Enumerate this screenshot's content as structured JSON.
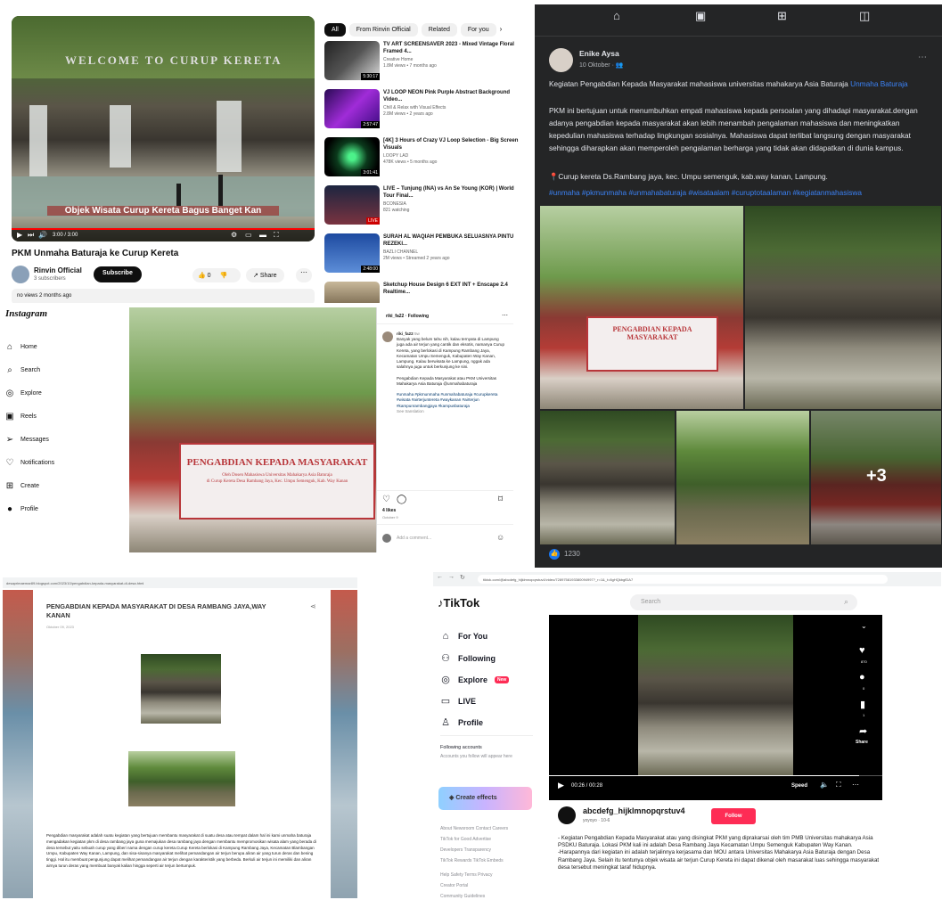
{
  "youtube": {
    "video_title": "PKM Unmaha Baturaja ke Curup Kereta",
    "sign_text": "WELCOME TO CURUP KERETA",
    "caption": "Objek Wisata Curup Kereta Bagus Banget Kan",
    "time": "3:00 / 3:00",
    "channel": "Rinvin Official",
    "subscribers": "3 subscribers",
    "subscribe_label": "Subscribe",
    "likes": "0",
    "share_label": "Share",
    "views": "no views  2 months ago",
    "chips": [
      "All",
      "From Rinvin Official",
      "Related",
      "For you"
    ],
    "recs": [
      {
        "title": "TV ART SCREENSAVER 2023 - Mixed Vintage Floral Framed 4...",
        "channel": "Creative Home",
        "meta": "1.8M views • 7 months ago",
        "duration": "5:30:17"
      },
      {
        "title": "VJ LOOP NEON Pink Purple Abstract Background Video...",
        "channel": "Chill & Relax with Visual Effects",
        "meta": "2.8M views • 2 years ago",
        "duration": "2:57:47"
      },
      {
        "title": "[4K] 3 Hours of Crazy VJ Loop Selection - Big Screen Visuals",
        "channel": "LOOPY LAD",
        "meta": "478K views • 5 months ago",
        "duration": "3:01:41"
      },
      {
        "title": "LIVE – Tunjung (INA) vs An Se Young (KOR) | World Tour Final...",
        "channel": "BCONESIA",
        "meta": "821 watching",
        "duration": "LIVE"
      },
      {
        "title": "SURAH AL WAQIAH PEMBUKA SELUASNYA PINTU REZEKI...",
        "channel": "BAZLI CHANNEL",
        "meta": "2M views • Streamed 2 years ago",
        "duration": "2:48:00"
      },
      {
        "title": "Sketchup House Design 6 EXT INT + Enscape 2.4 Realtime...",
        "channel": "",
        "meta": "",
        "duration": ""
      }
    ]
  },
  "facebook": {
    "author": "Enike Aysa",
    "date": "10 Oktober · ",
    "para1": "Kegiatan Pengabdian Kepada Masyarakat mahasiswa universitas mahakarya Asia Baturaja",
    "para1_link": "Unmaha Baturaja",
    "para2": "PKM ini bertujuan untuk menumbuhkan empati mahasiswa kepada persoalan yang dihadapi masyarakat.dengan adanya pengabdian kepada masyarakat akan lebih menambah pengalaman mahasiswa dan meningkatkan kepedulian mahasiswa terhadap lingkungan sosialnya. Mahasiswa dapat terlibat langsung dengan masyarakat sehingga diharapkan akan memperoleh pengalaman berharga yang tidak akan didapatkan di dunia kampus.",
    "location": "📍Curup kereta Ds.Rambang jaya, kec. Umpu semenguk, kab.way kanan, Lampung.",
    "hashtags": "#unmaha #pkmunmaha #unmahabaturaja #wisataalam #curuptotaalaman #kegiatanmahasiswa",
    "banner_title": "PENGABDIAN KEPADA MASYARAKAT",
    "more_photos": "+3",
    "reactions": "1230"
  },
  "instagram": {
    "logo": "Instagram",
    "nav": [
      "Home",
      "Search",
      "Explore",
      "Reels",
      "Messages",
      "Notifications",
      "Create",
      "Profile"
    ],
    "user": "riki_fa22 · Following",
    "comment_user": "riki_fa22",
    "comment_time": "5w",
    "caption": "Banyak yang belum tahu nih, kalau ternyata di Lampung juga ada air terjun yang cantik dan eksotis, namanya Curup Kereta, yang berlokasi di Kampung Rambang Jaya, Kecamatan Umpu Semenguk, Kabupaten Way Kanan, Lampung. Kalau berwisata ke Lampung, nggak ada salahnya juga untuk berkunjung ke sini.",
    "caption2": "Pengabdian Kepada Masyarakat atau PKM Universitas Mahakarya Asia Baturaja @unmahabaturaja",
    "hashtags": "#unmaha #pkmunmaha #unmahabaturaja #curupkereta #wisata #airterjuntereta #waykanan #airterjun #kampunrambangjaya #kampusbaturaja",
    "see_translation": "See translation",
    "likes": "4 likes",
    "ago": "October 9",
    "add_comment": "Add a comment...",
    "banner_title": "PENGABDIAN KEPADA MASYARAKAT",
    "banner_sub": "Oleh Dosen Mahasiswa Universitas Mahakarya Asia Baturaja",
    "banner_sub2": "di Curup Kereta Desa Rambang Jaya, Kec. Umpu Semenguk, Kab. Way Kanan"
  },
  "blog": {
    "url": "desaprimaemar89.blogspot.com/2023/10/pengabdian-kepada-masyarakat-di-desa.html",
    "title": "PENGABDIAN KEPADA MASYARAKAT DI DESA RAMBANG JAYA,WAY KANAN",
    "date": "Oktober 09, 2023",
    "body": "Pengabdian masyarakat adalah suatu kegiatan yang bertujuan membantu masyarakat di suatu desa atau tempat dalam hal ini kami unmaha baturaja mengadakan kegiatan pkm di desa rambang jaya guna memajukan desa rambang jaya dengan membantu mempromosikan wisata alam yang berada di desa tersebut yaitu sebuah curup yang diberi nama dengan curup kereta.Curup Kereta berlokasi di Kampung Rambang Jaya, Kecamatan Blambangan Umpu, Kabupaten Way Kanan, Lampung, dan sisa-sisanya masyarakat melihat pemandangan air terjun berupa aliran air yang turun deras dan bening tinggi. Hal itu membuat pengunjung dapat melihat pemandangan air terjun dengan karakteristik yang berbeda. Berkuli air terjun ini memiliki dan aliran airnya turun deras yang membuat banyak kalian hingga seperti air terjun bertumpuk."
  },
  "tiktok": {
    "url": "tiktok.com/@abcdefg_hijklmnopqrstuv4/video/7289758193380094997?_r=1&_t=8gHQkbgfDA7",
    "logo": "TikTok",
    "search_placeholder": "Search",
    "nav": [
      "For You",
      "Following",
      "Explore",
      "LIVE",
      "Profile"
    ],
    "explore_badge": "New",
    "following_accounts": "Following accounts",
    "following_hint": "Accounts you follow will appear here",
    "create_effects": "Create effects",
    "footer": [
      "About  Newsroom  Contact  Careers",
      "TikTok for Good  Advertise",
      "Developers  Transparency",
      "TikTok Rewards  TikTok Embeds",
      "Help  Safety  Terms  Privacy",
      "Creator Portal",
      "Community Guidelines"
    ],
    "video_time": "00:26 / 00:28",
    "speed": "Speed",
    "likes": "870",
    "comments": "0",
    "saves": "1",
    "share": "Share",
    "username": "abcdefg_hijklmnopqrstuv4",
    "subname": "yoyoyo · 10-6",
    "follow_label": "Follow",
    "desc": "- Kegiatan Pengabdian Kepada Masyarakat atau yang disingkat PKM yang diprakarsai oleh tim PMB Universitas mahakarya Asia PSDKU Baturaja. Lokasi PKM kali ini adalah Desa Rambang Jaya Kecamatan Umpu Semenguk Kabupaten Way Kanan.\n-Harapannya dari kegiatan ini adalah terjalinnya kerjasama dan MOU antara Universitas Mahakarya Asia Baturaja dengan Desa Rambang Jaya. Selain itu tentunya objek wisata air terjun Curup Kereta ini dapat dikenal oleh masarakat luas sehingga masyarakat desa tersebut meningkat taraf hidupnya."
  }
}
